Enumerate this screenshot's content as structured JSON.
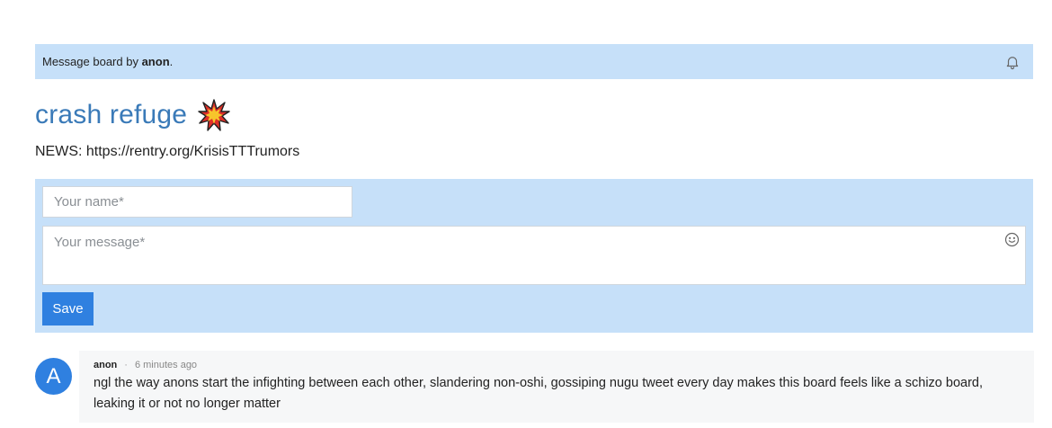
{
  "header": {
    "prefix": "Message board by ",
    "owner": "anon",
    "suffix": ".",
    "bell_icon": "bell-icon"
  },
  "board": {
    "title": "crash refuge",
    "title_emoji": "collision-emoji",
    "news": "NEWS: https://rentry.org/KrisisTTTrumors"
  },
  "form": {
    "name_placeholder": "Your name*",
    "name_value": "",
    "message_placeholder": "Your message*",
    "message_value": "",
    "emoji_icon": "smiley-icon",
    "save_label": "Save"
  },
  "comments": [
    {
      "avatar_letter": "A",
      "author": "anon",
      "separator": "·",
      "time": "6 minutes ago",
      "text": "ngl the way anons start the infighting between each other, slandering non-oshi, gossiping nugu tweet every day makes this board feels like a schizo board, leaking it or not no longer matter"
    }
  ],
  "colors": {
    "accent": "#2f80e0",
    "panel": "#c6e0f9",
    "title": "#3a7ab8"
  }
}
